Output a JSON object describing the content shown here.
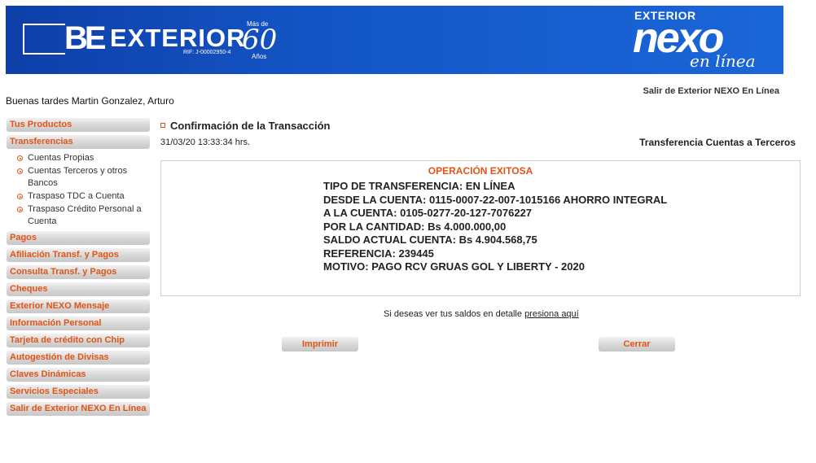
{
  "banner": {
    "bank_mark": "BE",
    "bank_name": "EXTERIOR",
    "rif": "RIF: J-00002950-4",
    "anniversary": {
      "prefix": "Más de",
      "number": "60",
      "suffix": "Años"
    },
    "product_top": "EXTERIOR",
    "product_name": "nexo",
    "product_sub": "en línea",
    "brand_color": "#1457c8"
  },
  "header": {
    "logout_label": "Salir de Exterior NEXO En Línea",
    "greeting": "Buenas tardes Martin Gonzalez, Arturo"
  },
  "sidebar": {
    "accent_color": "#e25416",
    "items": [
      {
        "label": "Tus Productos"
      },
      {
        "label": "Transferencias"
      },
      {
        "label": "Pagos"
      },
      {
        "label": "Afiliación Transf. y Pagos"
      },
      {
        "label": "Consulta Transf. y Pagos"
      },
      {
        "label": "Cheques"
      },
      {
        "label": "Exterior NEXO Mensaje"
      },
      {
        "label": "Información Personal"
      },
      {
        "label": "Tarjeta de crédito con Chip"
      },
      {
        "label": "Autogestión de Divisas"
      },
      {
        "label": "Claves Dinámicas"
      },
      {
        "label": "Servicios Especiales"
      },
      {
        "label": "Salir de Exterior NEXO En Línea"
      }
    ],
    "transfer_subitems": [
      {
        "label": "Cuentas Propias"
      },
      {
        "label": "Cuentas Terceros y otros Bancos"
      },
      {
        "label": "Traspaso TDC a Cuenta"
      },
      {
        "label": "Traspaso Crédito Personal a Cuenta"
      }
    ]
  },
  "main": {
    "title": "Confirmación de la Transacción",
    "timestamp": "31/03/20 13:33:34 hrs.",
    "transaction_type": "Transferencia Cuentas a Terceros",
    "result": {
      "status": "OPERACIÓN EXITOSA",
      "lines": [
        "TIPO DE TRANSFERENCIA: EN LÍNEA",
        "DESDE LA CUENTA: 0115-0007-22-007-1015166 AHORRO INTEGRAL",
        "A LA CUENTA: 0105-0277-20-127-7076227",
        "POR LA CANTIDAD: Bs 4.000.000,00",
        "SALDO ACTUAL CUENTA: Bs 4.904.568,75",
        "REFERENCIA: 239445",
        "MOTIVO: PAGO RCV GRUAS GOL Y LIBERTY - 2020"
      ]
    },
    "detail_prompt": "Si deseas ver tus saldos en detalle",
    "detail_link": "presiona aquí",
    "print_button": "Imprimir",
    "close_button": "Cerrar"
  }
}
